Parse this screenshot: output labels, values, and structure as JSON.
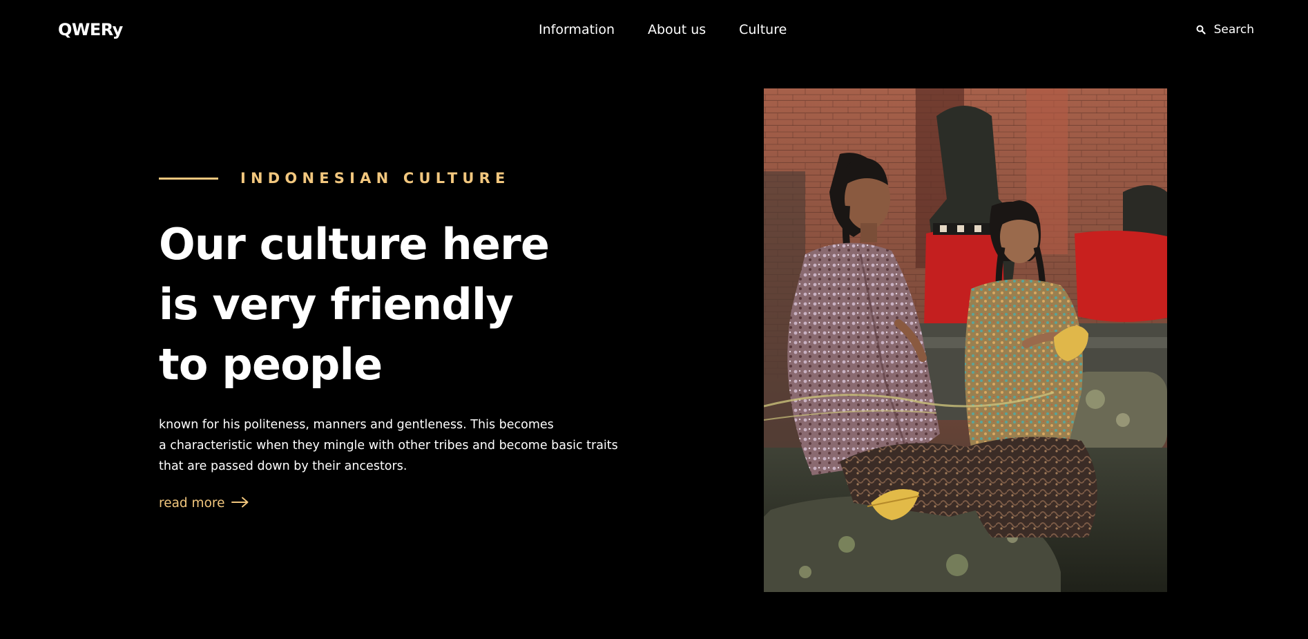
{
  "header": {
    "logo": "QWERy",
    "nav": [
      "Information",
      "About us",
      "Culture"
    ],
    "search_label": "Search"
  },
  "hero": {
    "eyebrow": "INDONESIAN CULTURE",
    "headline_lines": [
      "Our culture here",
      "is very friendly",
      "to people"
    ],
    "body_lines": [
      "known for his politeness, manners and gentleness. This becomes",
      "a characteristic when they mingle with other tribes and become basic traits",
      "that are passed down by their ancestors."
    ],
    "read_more": "read more"
  },
  "icons": {
    "search": "search-icon",
    "read_more_arrow": "arrow-right-icon"
  },
  "colors": {
    "background": "#000000",
    "text": "#ffffff",
    "accent": "#f2c77e"
  }
}
